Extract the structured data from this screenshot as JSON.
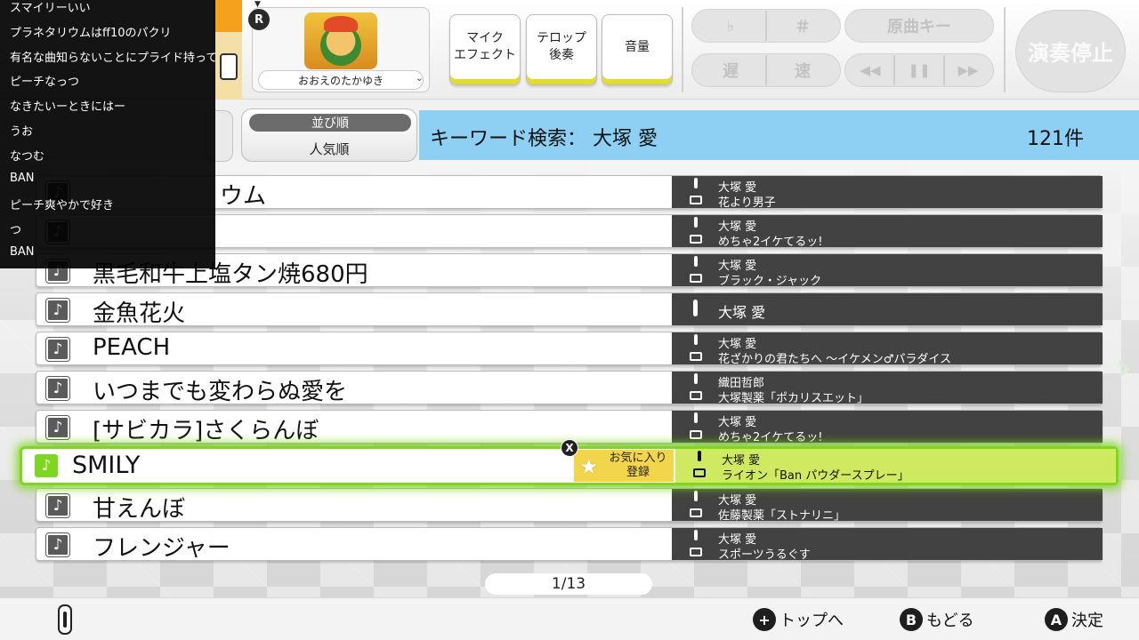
{
  "comments": [
    "スマイリーいい",
    "プラネタリウムはff10のパクリ",
    "有名な曲知らないことにプライド持って",
    "ピーチなっつ",
    "なきたいーときにはー",
    "うお",
    "なつむ",
    "BAN",
    "ピーチ爽やかで好き",
    "つ",
    "BAN"
  ],
  "profile": {
    "name": "おおえのたかゆき",
    "r_badge": "R"
  },
  "effects": [
    "マイク\nエフェクト",
    "テロップ\n後奏",
    "音量"
  ],
  "keys": {
    "flat": "♭",
    "sharp": "＃",
    "original": "原曲キー",
    "slow": "遅",
    "fast": "速",
    "rewind": "◀◀",
    "pause": "❚❚",
    "forward": "▶▶"
  },
  "stop_label": "演奏停止",
  "sort": {
    "header": "並び順",
    "value": "人気順"
  },
  "search": {
    "label": "キーワード検索：  大塚 愛",
    "count": "121件"
  },
  "songs": [
    {
      "title": "ウム",
      "artist": "大塚 愛",
      "tieup": "花より男子"
    },
    {
      "title": "",
      "artist": "大塚 愛",
      "tieup": "めちゃ2イケてるッ!"
    },
    {
      "title": "黒毛和牛上塩タン焼680円",
      "artist": "大塚 愛",
      "tieup": "ブラック・ジャック"
    },
    {
      "title": "金魚花火",
      "artist": "大塚 愛",
      "tieup": ""
    },
    {
      "title": "PEACH",
      "artist": "大塚 愛",
      "tieup": "花ざかりの君たちへ 〜イケメン♂パラダイス"
    },
    {
      "title": "いつまでも変わらぬ愛を",
      "artist": "織田哲郎",
      "tieup": "大塚製薬「ポカリスエット」"
    },
    {
      "title": "[サビカラ]さくらんぼ",
      "artist": "大塚 愛",
      "tieup": "めちゃ2イケてるッ!"
    },
    {
      "title": "SMILY",
      "artist": "大塚 愛",
      "tieup": "ライオン「Ban パウダースプレー」"
    },
    {
      "title": "甘えんぼ",
      "artist": "大塚 愛",
      "tieup": "佐藤製薬「ストナリニ」"
    },
    {
      "title": "フレンジャー",
      "artist": "大塚 愛",
      "tieup": "スポーツうるぐす"
    }
  ],
  "favorite_label": "お気に入り\n登録",
  "x_badge": "X",
  "pager": "1/13",
  "hints": [
    {
      "btn": "+",
      "label": "トップへ"
    },
    {
      "btn": "B",
      "label": "もどる"
    },
    {
      "btn": "A",
      "label": "決定"
    }
  ],
  "icons": {
    "note": "♪",
    "star": "★",
    "arrow": "›"
  }
}
